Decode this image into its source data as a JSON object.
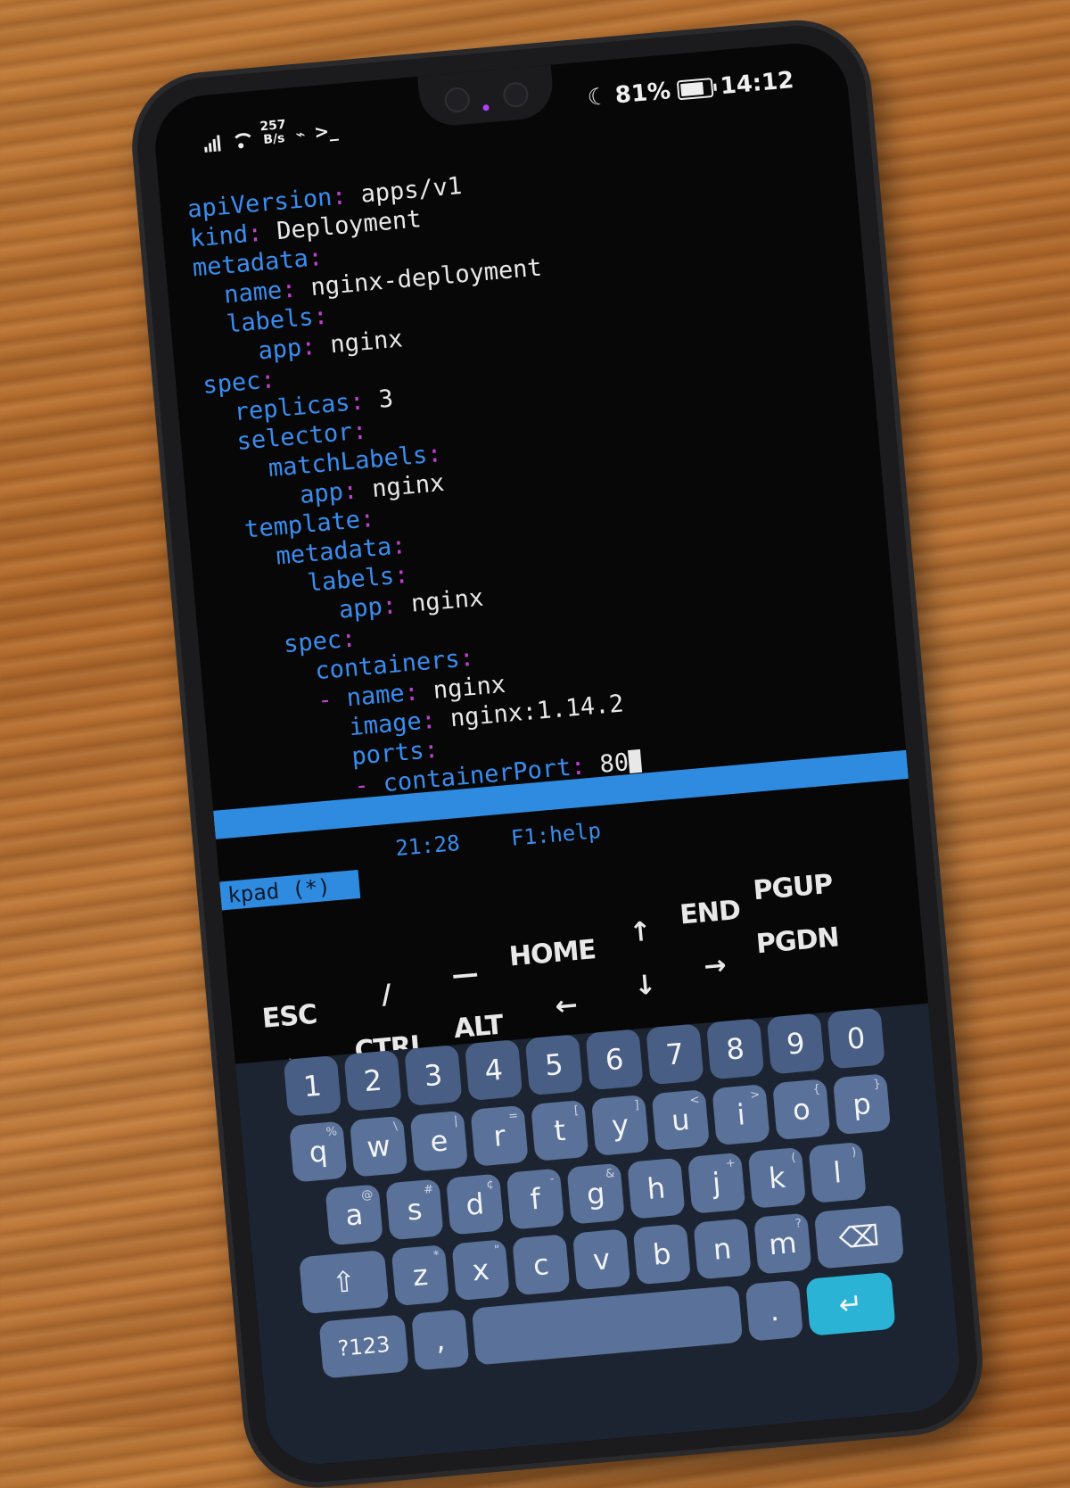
{
  "status_bar": {
    "netspeed_value": "257",
    "netspeed_unit": "B/s",
    "battery_percent": "81%",
    "battery_level": 0.81,
    "time": "14:12"
  },
  "terminal_lines": [
    {
      "indent": "",
      "key": "apiVersion",
      "sep": ":",
      "value": " apps/v1"
    },
    {
      "indent": "",
      "key": "kind",
      "sep": ":",
      "value": " Deployment"
    },
    {
      "indent": "",
      "key": "metadata",
      "sep": ":",
      "value": ""
    },
    {
      "indent": "  ",
      "key": "name",
      "sep": ":",
      "value": " nginx-deployment"
    },
    {
      "indent": "  ",
      "key": "labels",
      "sep": ":",
      "value": ""
    },
    {
      "indent": "    ",
      "key": "app",
      "sep": ":",
      "value": " nginx"
    },
    {
      "indent": "",
      "key": "spec",
      "sep": ":",
      "value": ""
    },
    {
      "indent": "  ",
      "key": "replicas",
      "sep": ":",
      "value": " 3"
    },
    {
      "indent": "  ",
      "key": "selector",
      "sep": ":",
      "value": ""
    },
    {
      "indent": "    ",
      "key": "matchLabels",
      "sep": ":",
      "value": ""
    },
    {
      "indent": "      ",
      "key": "app",
      "sep": ":",
      "value": " nginx"
    },
    {
      "indent": "  ",
      "key": "template",
      "sep": ":",
      "value": ""
    },
    {
      "indent": "    ",
      "key": "metadata",
      "sep": ":",
      "value": ""
    },
    {
      "indent": "      ",
      "key": "labels",
      "sep": ":",
      "value": ""
    },
    {
      "indent": "        ",
      "key": "app",
      "sep": ":",
      "value": " nginx"
    },
    {
      "indent": "    ",
      "key": "spec",
      "sep": ":",
      "value": ""
    },
    {
      "indent": "      ",
      "key": "containers",
      "sep": ":",
      "value": ""
    },
    {
      "indent": "      - ",
      "key": "name",
      "sep": ":",
      "value": " nginx"
    },
    {
      "indent": "        ",
      "key": "image",
      "sep": ":",
      "value": " nginx:1.14.2"
    },
    {
      "indent": "        ",
      "key": "ports",
      "sep": ":",
      "value": ""
    },
    {
      "indent": "        - ",
      "key": "containerPort",
      "sep": ":",
      "value": " 80"
    }
  ],
  "editor": {
    "position": "21:28",
    "help": "F1:help",
    "modified": "(*)",
    "name": "kpad"
  },
  "extra_keys": [
    "ESC",
    "/",
    "—",
    "HOME",
    "↑",
    "END",
    "PGUP",
    "⇆",
    "CTRL",
    "ALT",
    "←",
    "↓",
    "→",
    "PGDN"
  ],
  "keyboard": {
    "numbers": [
      "1",
      "2",
      "3",
      "4",
      "5",
      "6",
      "7",
      "8",
      "9",
      "0"
    ],
    "row1": [
      {
        "k": "q",
        "s": "%"
      },
      {
        "k": "w",
        "s": "\\"
      },
      {
        "k": "e",
        "s": "|"
      },
      {
        "k": "r",
        "s": "="
      },
      {
        "k": "t",
        "s": "["
      },
      {
        "k": "y",
        "s": "]"
      },
      {
        "k": "u",
        "s": "<"
      },
      {
        "k": "i",
        "s": ">"
      },
      {
        "k": "o",
        "s": "{"
      },
      {
        "k": "p",
        "s": "}"
      }
    ],
    "row2": [
      {
        "k": "a",
        "s": "@"
      },
      {
        "k": "s",
        "s": "#"
      },
      {
        "k": "d",
        "s": "¢"
      },
      {
        "k": "f",
        "s": "-"
      },
      {
        "k": "g",
        "s": "&"
      },
      {
        "k": "h",
        "s": ""
      },
      {
        "k": "j",
        "s": "+"
      },
      {
        "k": "k",
        "s": "("
      },
      {
        "k": "l",
        "s": ")"
      }
    ],
    "row3": [
      {
        "k": "z",
        "s": "*"
      },
      {
        "k": "x",
        "s": "\""
      },
      {
        "k": "c",
        "s": ""
      },
      {
        "k": "v",
        "s": ""
      },
      {
        "k": "b",
        "s": ""
      },
      {
        "k": "n",
        "s": ""
      },
      {
        "k": "m",
        "s": "?"
      }
    ],
    "shift": "⇧",
    "backspace": "⌫",
    "symbols": "?123",
    "comma": ",",
    "period": ".",
    "enter": "↵"
  }
}
